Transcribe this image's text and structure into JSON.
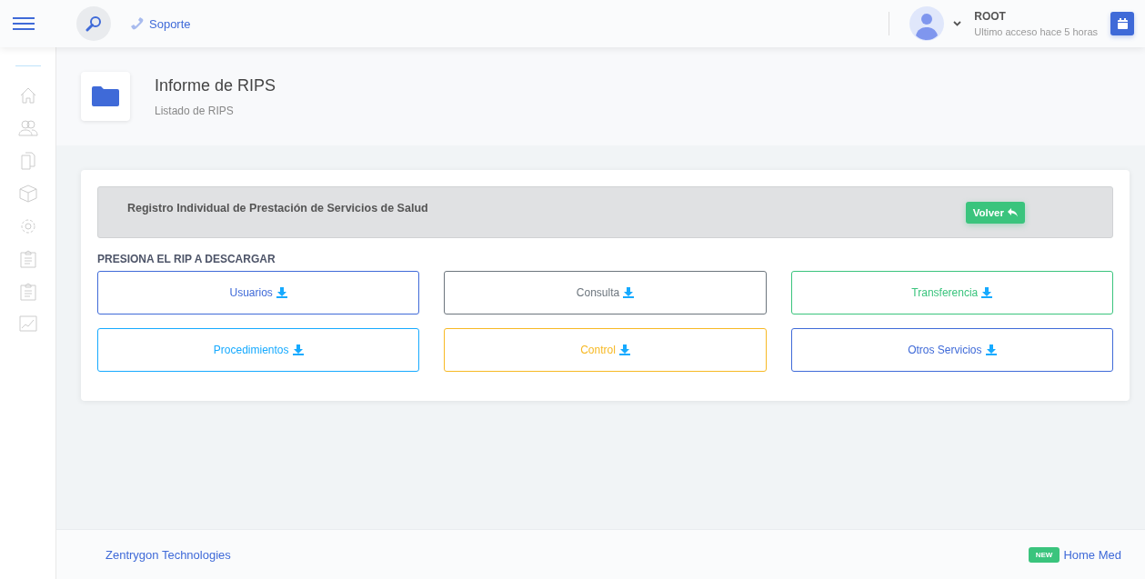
{
  "header": {
    "support_link": "Soporte",
    "user": {
      "name": "ROOT",
      "last_access": "Ultimo acceso hace 5 horas"
    }
  },
  "page_title": {
    "title": "Informe de RIPS",
    "subtitle": "Listado de RIPS"
  },
  "card": {
    "banner_title": "Registro Individual de Prestación de Servicios de Salud",
    "back_button": "Volver",
    "section_heading": "PRESIONA EL RIP A DESCARGAR",
    "downloads": [
      {
        "label": "Usuarios",
        "color": "#3f6ad8"
      },
      {
        "label": "Consulta",
        "color": "#6c757d"
      },
      {
        "label": "Transferencia",
        "color": "#3ac47d"
      },
      {
        "label": "Procedimientos",
        "color": "#16aaff"
      },
      {
        "label": "Control",
        "color": "#f7b924"
      },
      {
        "label": "Otros Servicios",
        "color": "#3f6ad8"
      }
    ]
  },
  "footer": {
    "company": "Zentrygon Technologies",
    "badge": "NEW",
    "app_link": "Home Med"
  }
}
